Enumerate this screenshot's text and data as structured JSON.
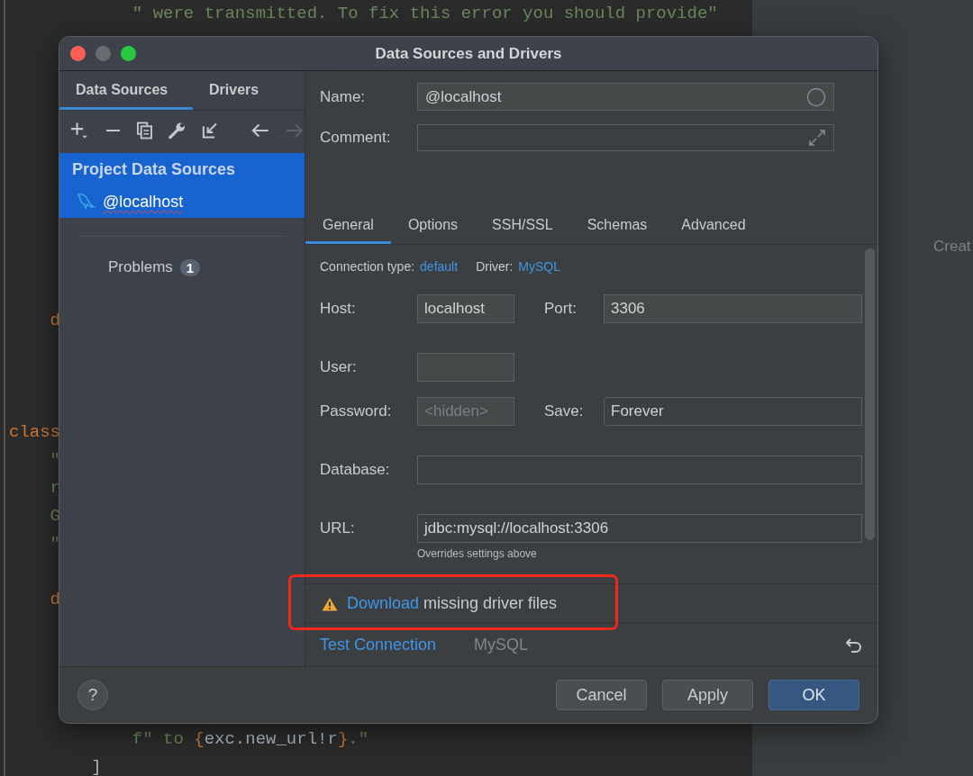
{
  "editor": {
    "lines": [
      {
        "segments": [
          {
            "kind": "string",
            "text": "            \" were transmitted. To fix this error you should provide\""
          }
        ]
      },
      {
        "segments": [
          {
            "kind": "keyword",
            "text": "    d"
          }
        ]
      },
      {
        "segments": [
          {
            "kind": "keyword",
            "text": "class"
          }
        ]
      },
      {
        "segments": [
          {
            "kind": "string",
            "text": "    \""
          }
        ]
      },
      {
        "segments": [
          {
            "kind": "string",
            "text": "    r"
          }
        ]
      },
      {
        "segments": [
          {
            "kind": "string",
            "text": "    G"
          }
        ]
      },
      {
        "segments": [
          {
            "kind": "string",
            "text": "    \""
          }
        ]
      },
      {
        "segments": [
          {
            "kind": "keyword",
            "text": "    d"
          }
        ]
      },
      {
        "segments": [
          {
            "kind": "string",
            "text": "            f\" to "
          },
          {
            "kind": "keyword",
            "text": "{"
          },
          {
            "kind": "plain",
            "text": "exc.new_url!r"
          },
          {
            "kind": "keyword",
            "text": "}"
          },
          {
            "kind": "string",
            "text": ".\""
          }
        ]
      },
      {
        "segments": [
          {
            "kind": "plain",
            "text": "        ]"
          }
        ]
      }
    ]
  },
  "side_panel": {
    "text": "Creat"
  },
  "dialog": {
    "title": "Data Sources and Drivers",
    "left_tabs": [
      {
        "label": "Data Sources",
        "selected": true
      },
      {
        "label": "Drivers",
        "selected": false
      }
    ],
    "toolbar": [
      {
        "kind": "add",
        "disabled": false
      },
      {
        "kind": "remove",
        "disabled": false
      },
      {
        "kind": "copy",
        "disabled": false
      },
      {
        "kind": "wrench",
        "disabled": false
      },
      {
        "kind": "import",
        "disabled": false
      },
      {
        "kind": "back",
        "disabled": false
      },
      {
        "kind": "forward",
        "disabled": true
      }
    ],
    "tree": [
      {
        "label": "Project Data Sources",
        "selected": true,
        "children": [
          {
            "label": "@localhost",
            "selected": true
          }
        ]
      }
    ],
    "problems": {
      "label": "Problems",
      "count": "1"
    },
    "name": {
      "label": "Name:",
      "value": "@localhost"
    },
    "comment": {
      "label": "Comment:"
    },
    "tabs": [
      {
        "label": "General",
        "selected": true
      },
      {
        "label": "Options",
        "selected": false
      },
      {
        "label": "SSH/SSL",
        "selected": false
      },
      {
        "label": "Schemas",
        "selected": false
      },
      {
        "label": "Advanced",
        "selected": false
      }
    ],
    "connection_type": {
      "label": "Connection type:",
      "value": "default"
    },
    "driver": {
      "label": "Driver:",
      "value": "MySQL"
    },
    "form": [
      {
        "label": "Host:",
        "value": "localhost",
        "kind": "short",
        "pair": {
          "label": "Port:",
          "value": "3306",
          "kind": "text"
        }
      },
      {
        "label": "User:",
        "kind": "short"
      },
      {
        "label": "Password:",
        "placeholder": "<hidden>",
        "kind": "short",
        "pair": {
          "label": "Save:",
          "value": "Forever",
          "kind": "select"
        }
      },
      {
        "label": "Database:",
        "kind": "wide"
      },
      {
        "label": "URL:",
        "value": "jdbc:mysql://localhost:3306",
        "kind": "wide",
        "hint": "Overrides settings above"
      }
    ],
    "warning": {
      "link": "Download",
      "text": " missing driver files"
    },
    "test_connection": "Test Connection",
    "driver_name": "MySQL",
    "help": "?",
    "buttons": [
      {
        "label": "Cancel",
        "kind": "default"
      },
      {
        "label": "Apply",
        "kind": "default"
      },
      {
        "label": "OK",
        "kind": "primary"
      }
    ]
  }
}
